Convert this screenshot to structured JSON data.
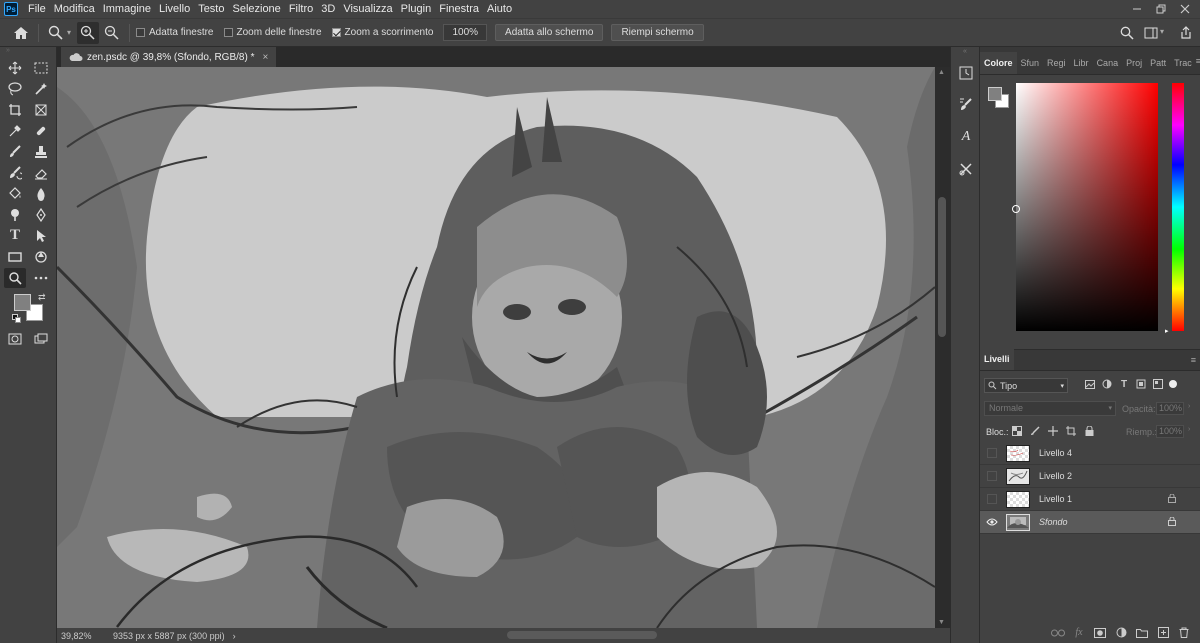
{
  "app": {
    "logo": "Ps"
  },
  "menu": [
    "File",
    "Modifica",
    "Immagine",
    "Livello",
    "Testo",
    "Selezione",
    "Filtro",
    "3D",
    "Visualizza",
    "Plugin",
    "Finestra",
    "Aiuto"
  ],
  "options": {
    "fit_windows": "Adatta finestre",
    "zoom_all": "Zoom delle finestre",
    "scrubby_zoom": "Zoom a scorrimento",
    "zoom_value": "100%",
    "fit_screen": "Adatta allo schermo",
    "fill_screen": "Riempi schermo"
  },
  "document": {
    "tab_title": "zen.psdc @ 39,8% (Sfondo, RGB/8) *",
    "close_glyph": "×"
  },
  "status": {
    "zoom": "39,82%",
    "doc_info": "9353 px x 5887 px (300 ppi)",
    "arrow": "›"
  },
  "color_panel": {
    "tabs": [
      "Colore",
      "Sfun",
      "Regi",
      "Libr",
      "Cana",
      "Proj",
      "Patt",
      "Trac"
    ],
    "active_tab": "Colore",
    "hue_base": "#ff0000"
  },
  "layers_panel": {
    "tab": "Livelli",
    "filter_kind": "Tipo",
    "blend_mode": "Normale",
    "opacity_label": "Opacità:",
    "opacity_value": "100%",
    "lock_label": "Bloc.:",
    "fill_label": "Riemp.:",
    "fill_value": "100%",
    "layers": [
      {
        "name": "Livello 4",
        "visible": false,
        "locked": false,
        "selected": false
      },
      {
        "name": "Livello 2",
        "visible": false,
        "locked": false,
        "selected": false
      },
      {
        "name": "Livello 1",
        "visible": false,
        "locked": true,
        "selected": false
      },
      {
        "name": "Sfondo",
        "visible": true,
        "locked": true,
        "selected": true
      }
    ]
  }
}
